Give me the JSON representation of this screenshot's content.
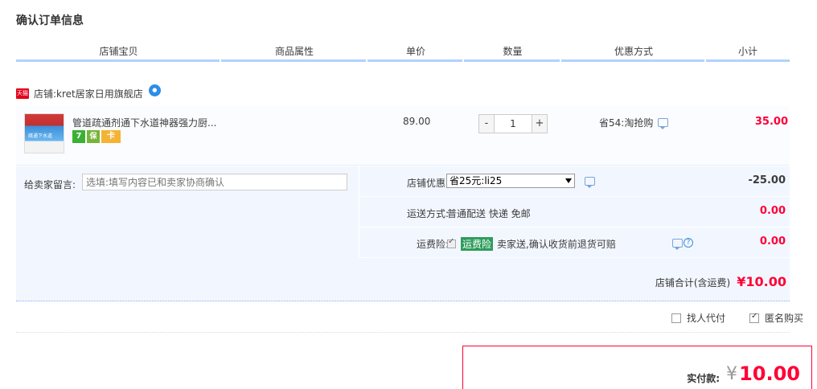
{
  "page_title": "确认订单信息",
  "columns": [
    "店铺宝贝",
    "商品属性",
    "单价",
    "数量",
    "优惠方式",
    "小计"
  ],
  "shop": {
    "badge_text": "天猫",
    "label": "店铺:",
    "name": "kret居家日用旗舰店",
    "ww_icon": "wangwang-icon"
  },
  "item": {
    "title": "管道疏通剂通下水道神器强力厨...",
    "thumb_text": "疏通下水道",
    "badges": [
      "7",
      "保",
      "卡"
    ],
    "unit_price": "89.00",
    "quantity": "1",
    "minus": "-",
    "plus": "+",
    "promo": "省54:淘抢购",
    "subtotal": "35.00"
  },
  "memo": {
    "label": "给卖家留言:",
    "placeholder": "选填:填写内容已和卖家协商确认"
  },
  "shop_discount": {
    "label": "店铺优惠:",
    "selected": "省25元:li25",
    "amount": "-25.00"
  },
  "shipping": {
    "label": "运送方式:",
    "value": "普通配送 快递 免邮",
    "amount": "0.00"
  },
  "insurance": {
    "label": "运费险:",
    "highlight": "运费险",
    "desc": "卖家送,确认收货前退货可赔",
    "amount": "0.00",
    "help": "?"
  },
  "shop_total": {
    "label": "店铺合计(含运费)",
    "amount": "¥10.00"
  },
  "options": {
    "pay_for_me": "找人代付",
    "anonymous": "匿名购买"
  },
  "payment": {
    "label": "实付款:",
    "yen": "¥",
    "amount": "10.00"
  },
  "colors": {
    "accent_red": "#ff0036",
    "header_bar": "#b2d1ff",
    "detail_bg": "#f2f7ff"
  }
}
